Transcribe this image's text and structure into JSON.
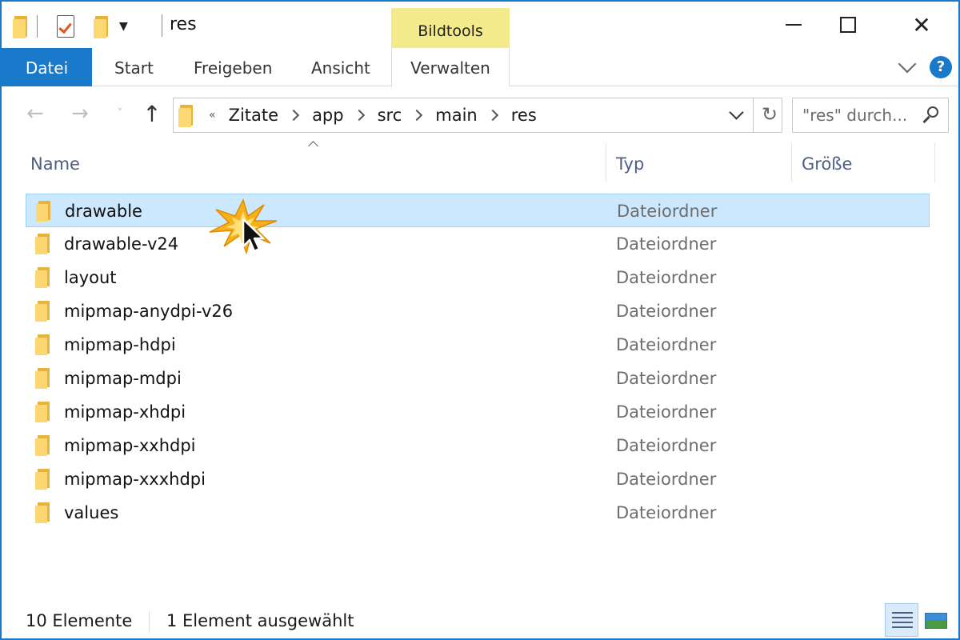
{
  "window": {
    "title": "res",
    "context_tab_group": "Bildtools"
  },
  "ribbon": {
    "tabs": [
      {
        "label": "Datei"
      },
      {
        "label": "Start"
      },
      {
        "label": "Freigeben"
      },
      {
        "label": "Ansicht"
      },
      {
        "label": "Verwalten"
      }
    ],
    "help_label": "?"
  },
  "address": {
    "overflow_marker": "«",
    "crumbs": [
      "Zitate",
      "app",
      "src",
      "main",
      "res"
    ]
  },
  "search": {
    "placeholder": "\"res\" durch..."
  },
  "columns": {
    "name": "Name",
    "type": "Typ",
    "size": "Größe"
  },
  "files": [
    {
      "name": "drawable",
      "type": "Dateiordner",
      "selected": true
    },
    {
      "name": "drawable-v24",
      "type": "Dateiordner"
    },
    {
      "name": "layout",
      "type": "Dateiordner"
    },
    {
      "name": "mipmap-anydpi-v26",
      "type": "Dateiordner"
    },
    {
      "name": "mipmap-hdpi",
      "type": "Dateiordner"
    },
    {
      "name": "mipmap-mdpi",
      "type": "Dateiordner"
    },
    {
      "name": "mipmap-xhdpi",
      "type": "Dateiordner"
    },
    {
      "name": "mipmap-xxhdpi",
      "type": "Dateiordner"
    },
    {
      "name": "mipmap-xxxhdpi",
      "type": "Dateiordner"
    },
    {
      "name": "values",
      "type": "Dateiordner"
    }
  ],
  "status": {
    "count": "10 Elemente",
    "selection": "1 Element ausgewählt"
  },
  "colors": {
    "accent": "#1979ca",
    "selection_bg": "#cce8ff",
    "context_tab": "#f3ea8c",
    "folder": "#fcd670"
  },
  "icons": {
    "qat": [
      "folder-icon",
      "properties-check-icon",
      "new-folder-icon",
      "customize-dropdown-icon"
    ],
    "nav": [
      "back-arrow-icon",
      "forward-arrow-icon",
      "recent-locations-icon",
      "up-arrow-icon"
    ],
    "address": [
      "folder-icon",
      "chevron-down-icon",
      "refresh-icon"
    ],
    "search": "search-icon",
    "views": [
      "details-view-icon",
      "large-icons-view-icon"
    ]
  }
}
